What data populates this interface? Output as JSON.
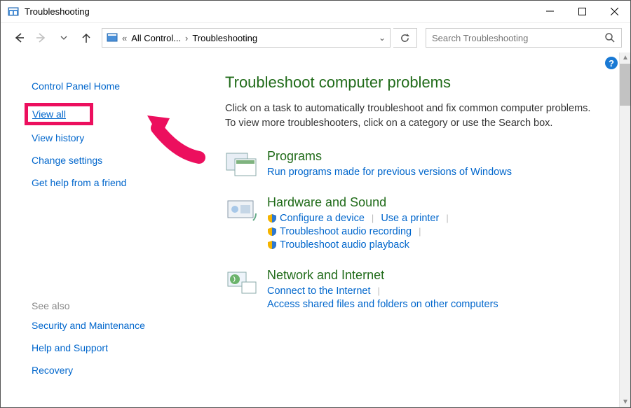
{
  "window": {
    "title": "Troubleshooting"
  },
  "addressbar": {
    "segments": [
      "All Control...",
      "Troubleshooting"
    ],
    "refresh_tooltip": "Refresh"
  },
  "search": {
    "placeholder": "Search Troubleshooting"
  },
  "sidebar": {
    "home": "Control Panel Home",
    "items": [
      "View all",
      "View history",
      "Change settings",
      "Get help from a friend"
    ],
    "see_also_label": "See also",
    "see_also": [
      "Security and Maintenance",
      "Help and Support",
      "Recovery"
    ]
  },
  "main": {
    "heading": "Troubleshoot computer problems",
    "description": "Click on a task to automatically troubleshoot and fix common computer problems. To view more troubleshooters, click on a category or use the Search box.",
    "categories": [
      {
        "title": "Programs",
        "links": [
          {
            "label": "Run programs made for previous versions of Windows",
            "shield": false
          }
        ]
      },
      {
        "title": "Hardware and Sound",
        "links": [
          {
            "label": "Configure a device",
            "shield": true
          },
          {
            "label": "Use a printer",
            "shield": false
          },
          {
            "label": "Troubleshoot audio recording",
            "shield": true
          },
          {
            "label": "Troubleshoot audio playback",
            "shield": true
          }
        ]
      },
      {
        "title": "Network and Internet",
        "links": [
          {
            "label": "Connect to the Internet",
            "shield": false
          },
          {
            "label": "Access shared files and folders on other computers",
            "shield": false
          }
        ]
      }
    ]
  },
  "annotation": {
    "highlighted_item_index": 0
  },
  "colors": {
    "accent_green": "#206b19",
    "link_blue": "#0066cc",
    "annotation_pink": "#ec0f5e"
  }
}
